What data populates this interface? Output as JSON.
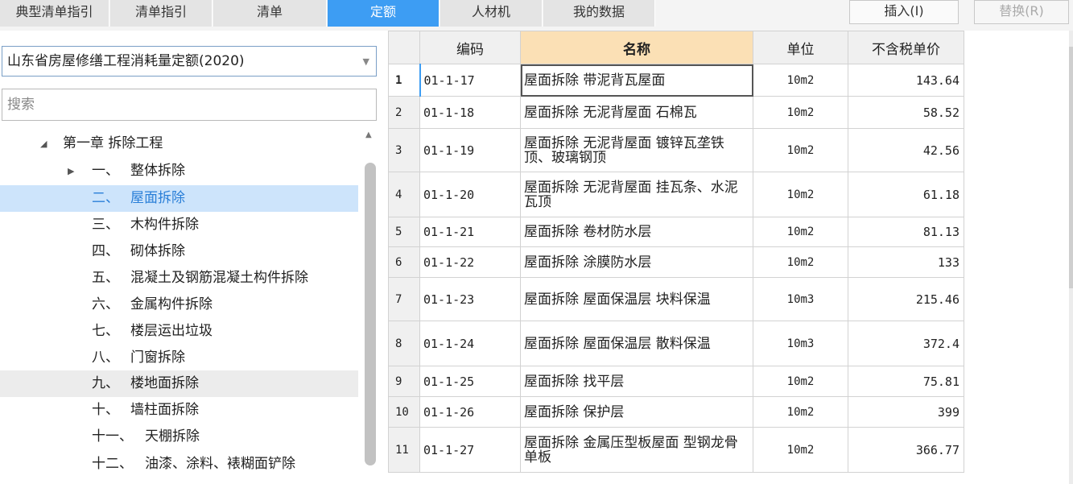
{
  "tabs": [
    {
      "label": "典型清单指引",
      "active": false
    },
    {
      "label": "清单指引",
      "active": false
    },
    {
      "label": "清单",
      "active": false
    },
    {
      "label": "定额",
      "active": true
    },
    {
      "label": "人材机",
      "active": false
    },
    {
      "label": "我的数据",
      "active": false
    }
  ],
  "buttons": {
    "insert": "插入(I)",
    "replace": "替换(R)"
  },
  "left_panel": {
    "selected_library": "山东省房屋修缮工程消耗量定额(2020)",
    "search_placeholder": "搜索",
    "tree": {
      "chapter": "第一章 拆除工程",
      "items": [
        {
          "num": "一、",
          "label": "整体拆除",
          "expandable": true
        },
        {
          "num": "二、",
          "label": "屋面拆除",
          "selected": true
        },
        {
          "num": "三、",
          "label": "木构件拆除"
        },
        {
          "num": "四、",
          "label": "砌体拆除"
        },
        {
          "num": "五、",
          "label": "混凝土及钢筋混凝土构件拆除"
        },
        {
          "num": "六、",
          "label": "金属构件拆除"
        },
        {
          "num": "七、",
          "label": "楼层运出垃圾"
        },
        {
          "num": "八、",
          "label": "门窗拆除"
        },
        {
          "num": "九、",
          "label": "楼地面拆除",
          "hover": true
        },
        {
          "num": "十、",
          "label": "墙柱面拆除"
        },
        {
          "num": "十一、",
          "label": "天棚拆除"
        },
        {
          "num": "十二、",
          "label": "油漆、涂料、裱糊面铲除"
        }
      ]
    }
  },
  "table": {
    "headers": {
      "code": "编码",
      "name": "名称",
      "unit": "单位",
      "price": "不含税单价"
    },
    "rows": [
      {
        "idx": "1",
        "code": "01-1-17",
        "name": "屋面拆除 带泥背瓦屋面",
        "unit": "10m2",
        "price": "143.64"
      },
      {
        "idx": "2",
        "code": "01-1-18",
        "name": "屋面拆除 无泥背屋面 石棉瓦",
        "unit": "10m2",
        "price": "58.52"
      },
      {
        "idx": "3",
        "code": "01-1-19",
        "name": "屋面拆除 无泥背屋面 镀锌瓦垄铁顶、玻璃钢顶",
        "unit": "10m2",
        "price": "42.56"
      },
      {
        "idx": "4",
        "code": "01-1-20",
        "name": "屋面拆除 无泥背屋面 挂瓦条、水泥瓦顶",
        "unit": "10m2",
        "price": "61.18"
      },
      {
        "idx": "5",
        "code": "01-1-21",
        "name": "屋面拆除 卷材防水层",
        "unit": "10m2",
        "price": "81.13"
      },
      {
        "idx": "6",
        "code": "01-1-22",
        "name": "屋面拆除 涂膜防水层",
        "unit": "10m2",
        "price": "133"
      },
      {
        "idx": "7",
        "code": "01-1-23",
        "name": "屋面拆除 屋面保温层 块料保温",
        "unit": "10m3",
        "price": "215.46"
      },
      {
        "idx": "8",
        "code": "01-1-24",
        "name": "屋面拆除 屋面保温层 散料保温",
        "unit": "10m3",
        "price": "372.4"
      },
      {
        "idx": "9",
        "code": "01-1-25",
        "name": "屋面拆除 找平层",
        "unit": "10m2",
        "price": "75.81"
      },
      {
        "idx": "10",
        "code": "01-1-26",
        "name": "屋面拆除 保护层",
        "unit": "10m2",
        "price": "399"
      },
      {
        "idx": "11",
        "code": "01-1-27",
        "name": "屋面拆除 金属压型板屋面 型钢龙骨 单板",
        "unit": "10m2",
        "price": "366.77"
      }
    ]
  },
  "colors": {
    "accent": "#3d9df3",
    "selected_row": "#cde4fb",
    "name_header": "#fbe0b5"
  }
}
